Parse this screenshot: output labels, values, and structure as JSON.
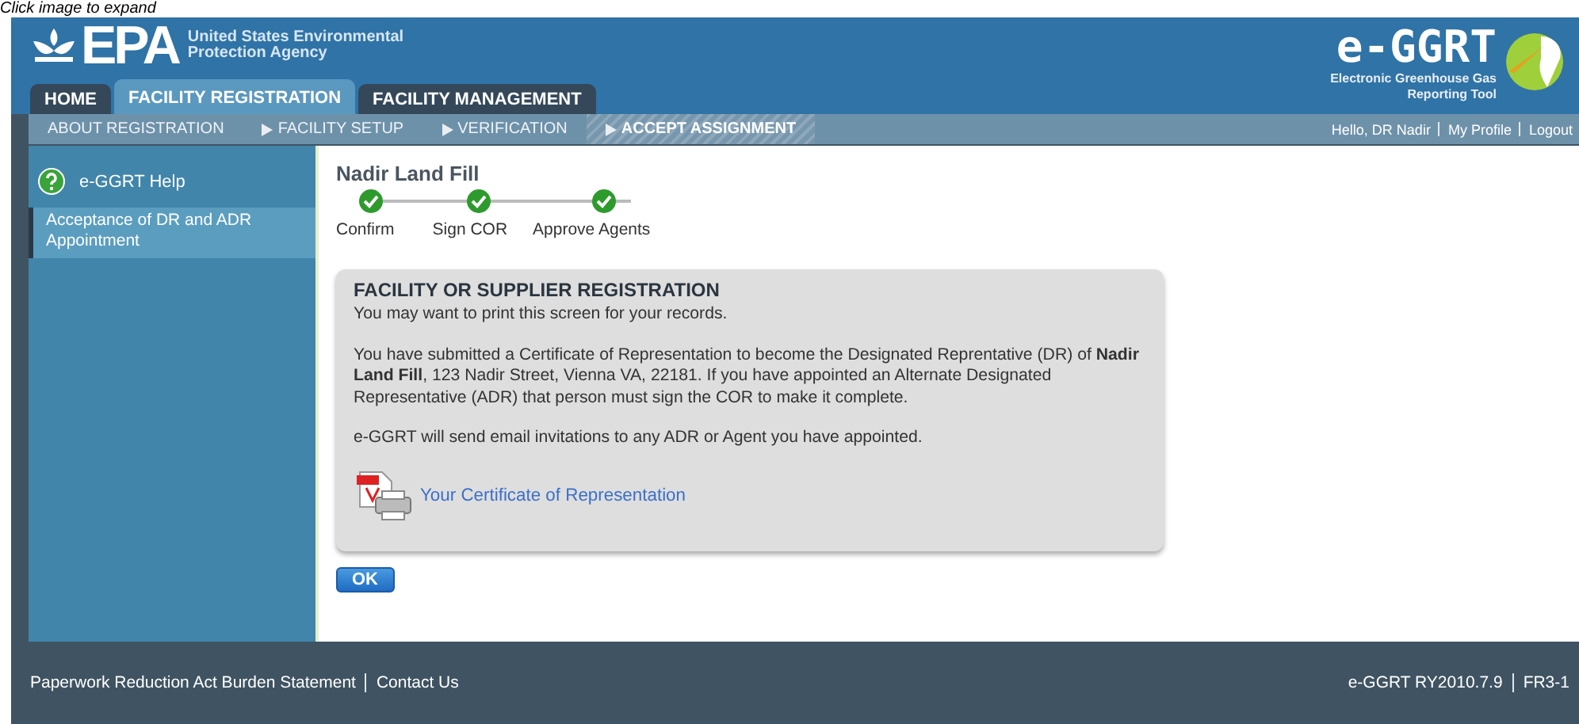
{
  "caption": "Click image to expand",
  "header": {
    "agency_logo": "EPA",
    "agency_name": "United States Environmental Protection Agency",
    "tool_logo": "e-GGRT",
    "tool_name": "Electronic Greenhouse Gas Reporting Tool"
  },
  "tabs": [
    {
      "label": "HOME",
      "selected": false
    },
    {
      "label": "FACILITY REGISTRATION",
      "selected": true
    },
    {
      "label": "FACILITY MANAGEMENT",
      "selected": false
    }
  ],
  "subnav": [
    {
      "label": "ABOUT REGISTRATION",
      "selected": false,
      "arrow": false
    },
    {
      "label": "FACILITY SETUP",
      "selected": false,
      "arrow": true
    },
    {
      "label": "VERIFICATION",
      "selected": false,
      "arrow": true
    },
    {
      "label": "ACCEPT ASSIGNMENT",
      "selected": true,
      "arrow": true
    }
  ],
  "user_links": [
    "Hello, DR Nadir",
    "My Profile",
    "Logout"
  ],
  "sidebar": {
    "help": "e-GGRT Help",
    "items": [
      {
        "label": "Acceptance of DR and ADR Appointment"
      }
    ]
  },
  "facility_name": "Nadir Land Fill",
  "steps": [
    {
      "label": "Confirm",
      "done": true
    },
    {
      "label": "Sign COR",
      "done": true
    },
    {
      "label": "Approve Agents",
      "done": true
    }
  ],
  "panel": {
    "title": "FACILITY OR SUPPLIER REGISTRATION",
    "paragraphs": [
      "You may want to print this screen for your records.",
      "You have submitted a Certificate of Representation to become the Designated Reprentative (DR) of **Nadir Land Fill**, 123 Nadir Street, Vienna VA, 22181. If you have appointed an Alternate Designated Representative (ADR) that person must sign the COR to make it complete.",
      "e-GGRT will send email invitations to any ADR or Agent you have appointed."
    ],
    "link": "Your Certificate of Representation"
  },
  "ok_button": "OK",
  "footer": {
    "left": [
      "Paperwork Reduction Act Burden Statement",
      "Contact Us"
    ],
    "right": [
      "e-GGRT RY2010.7.9",
      "FR3-1"
    ]
  }
}
